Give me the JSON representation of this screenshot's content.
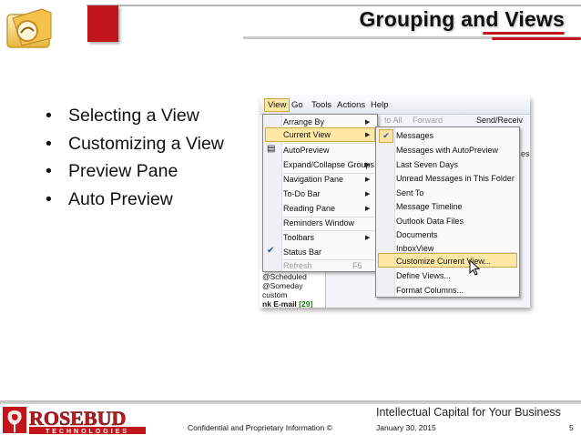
{
  "header": {
    "title": "Grouping and Views"
  },
  "bullets": [
    "Selecting a View",
    "Customizing a View",
    "Preview Pane",
    "Auto Preview"
  ],
  "screenshot": {
    "menubar": [
      "View",
      "Go",
      "Tools",
      "Actions",
      "Help"
    ],
    "toolbar_fragment": "to All",
    "toolbar_forward": "Forward",
    "toolbar_send": "Send/Receiv",
    "view_menu": {
      "items": [
        "Arrange By",
        "Current View",
        "AutoPreview",
        "Expand/Collapse Groups",
        "Navigation Pane",
        "To-Do Bar",
        "Reading Pane",
        "Reminders Window",
        "Toolbars",
        "Status Bar",
        "Refresh"
      ],
      "refresh_shortcut": "F5"
    },
    "current_view_submenu": {
      "items": [
        "Messages",
        "Messages with AutoPreview",
        "Last Seven Days",
        "Unread Messages in This Folder",
        "Sent To",
        "Message Timeline",
        "Outlook Data Files",
        "Documents",
        "InboxView",
        "Customize Current View...",
        "Define Views...",
        "Format Columns..."
      ],
      "highlighted": "Customize Current View..."
    },
    "left_pane": {
      "items": [
        "@Scheduled",
        "@Someday",
        "custom"
      ],
      "junk_label": "nk E-mail",
      "junk_count": "[29]"
    },
    "right_fragment": "es"
  },
  "footer": {
    "tagline": "Intellectual Capital for Your Business",
    "confidential": "Confidential and Proprietary Information ©",
    "date": "January 30, 2015",
    "page": "5",
    "logo_text": "ROSEBUD",
    "logo_subtext": "TECHNOLOGIES"
  },
  "colors": {
    "accent_red": "#c3161c",
    "menu_highlight": "#ffe8a6"
  },
  "icons": [
    "outlook-logo-icon",
    "rosebud-logo-icon",
    "checkmark-icon",
    "submenu-arrow-icon",
    "mouse-cursor-icon"
  ]
}
